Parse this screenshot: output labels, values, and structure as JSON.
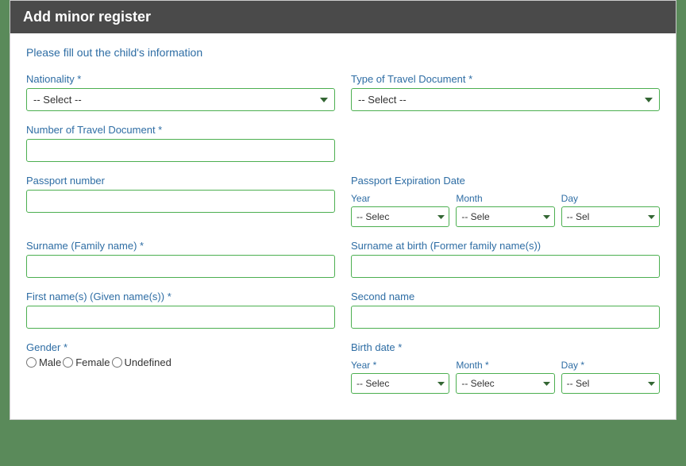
{
  "modal": {
    "title": "Add minor register",
    "subtitle": "Please fill out the child's information"
  },
  "form": {
    "nationality": {
      "label": "Nationality *",
      "placeholder": "-- Select --"
    },
    "travel_doc_type": {
      "label": "Type of Travel Document *",
      "placeholder": "-- Select --"
    },
    "travel_doc_number": {
      "label": "Number of Travel Document *",
      "placeholder": ""
    },
    "passport_number": {
      "label": "Passport number",
      "placeholder": ""
    },
    "passport_expiry": {
      "label": "Passport Expiration Date",
      "year_label": "Year",
      "month_label": "Month",
      "day_label": "Day",
      "year_placeholder": "-- Select",
      "month_placeholder": "-- Sele",
      "day_placeholder": "-- Sel"
    },
    "surname": {
      "label": "Surname (Family name) *",
      "placeholder": ""
    },
    "surname_birth": {
      "label": "Surname at birth (Former family name(s))",
      "placeholder": ""
    },
    "first_name": {
      "label": "First name(s) (Given name(s)) *",
      "placeholder": ""
    },
    "second_name": {
      "label": "Second name",
      "placeholder": ""
    },
    "gender": {
      "label": "Gender *",
      "options": [
        "Male",
        "Female",
        "Undefined"
      ]
    },
    "birth_date": {
      "label": "Birth date *",
      "year_label": "Year *",
      "month_label": "Month *",
      "day_label": "Day *",
      "year_placeholder": "-- Selec",
      "month_placeholder": "-- Selec",
      "day_placeholder": "-- Sel"
    }
  }
}
